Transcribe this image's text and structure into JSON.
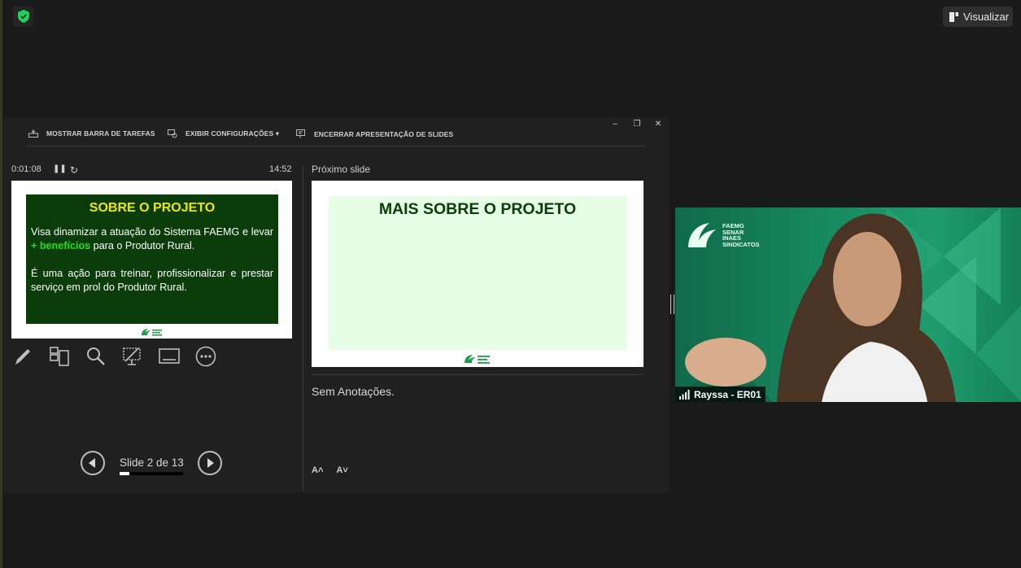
{
  "top_bar": {
    "view_button_label": "Visualizar"
  },
  "presenter": {
    "toolbar": {
      "taskbar_label": "MOSTRAR BARRA DE TAREFAS",
      "display_settings_label": "EXIBIR CONFIGURAÇÕES ▾",
      "end_show_label": "ENCERRAR APRESENTAÇÃO DE SLIDES"
    },
    "elapsed_time": "0:01:08",
    "clock": "14:52",
    "current_slide": {
      "title": "SOBRE O PROJETO",
      "para1_a": "Visa dinamizar a atuação do Sistema FAEMG e levar ",
      "para1_highlight": "+ benefícios",
      "para1_b": " para o Produtor Rural.",
      "para2": "É uma ação para treinar, profissionalizar e prestar serviço em prol do Produtor Rural."
    },
    "next_label": "Próximo slide",
    "next_slide": {
      "title": "MAIS SOBRE O PROJETO"
    },
    "notes": "Sem Anotações.",
    "font_increase": "A˄",
    "font_decrease": "A˅",
    "slide_counter": "Slide 2 de 13",
    "slide_progress": 0.15
  },
  "video": {
    "logo_lines": [
      "FAEMG",
      "SENAR",
      "INAES",
      "SINDICATOS"
    ],
    "participant_name": "Rayssa - ER01"
  },
  "colors": {
    "slide_green": "#0a3d0a",
    "slide_title_yellow": "#f2e600",
    "highlight_green": "#1fe01f",
    "next_slide_bg": "#e6fde6",
    "video_bg": "#178a5f"
  }
}
